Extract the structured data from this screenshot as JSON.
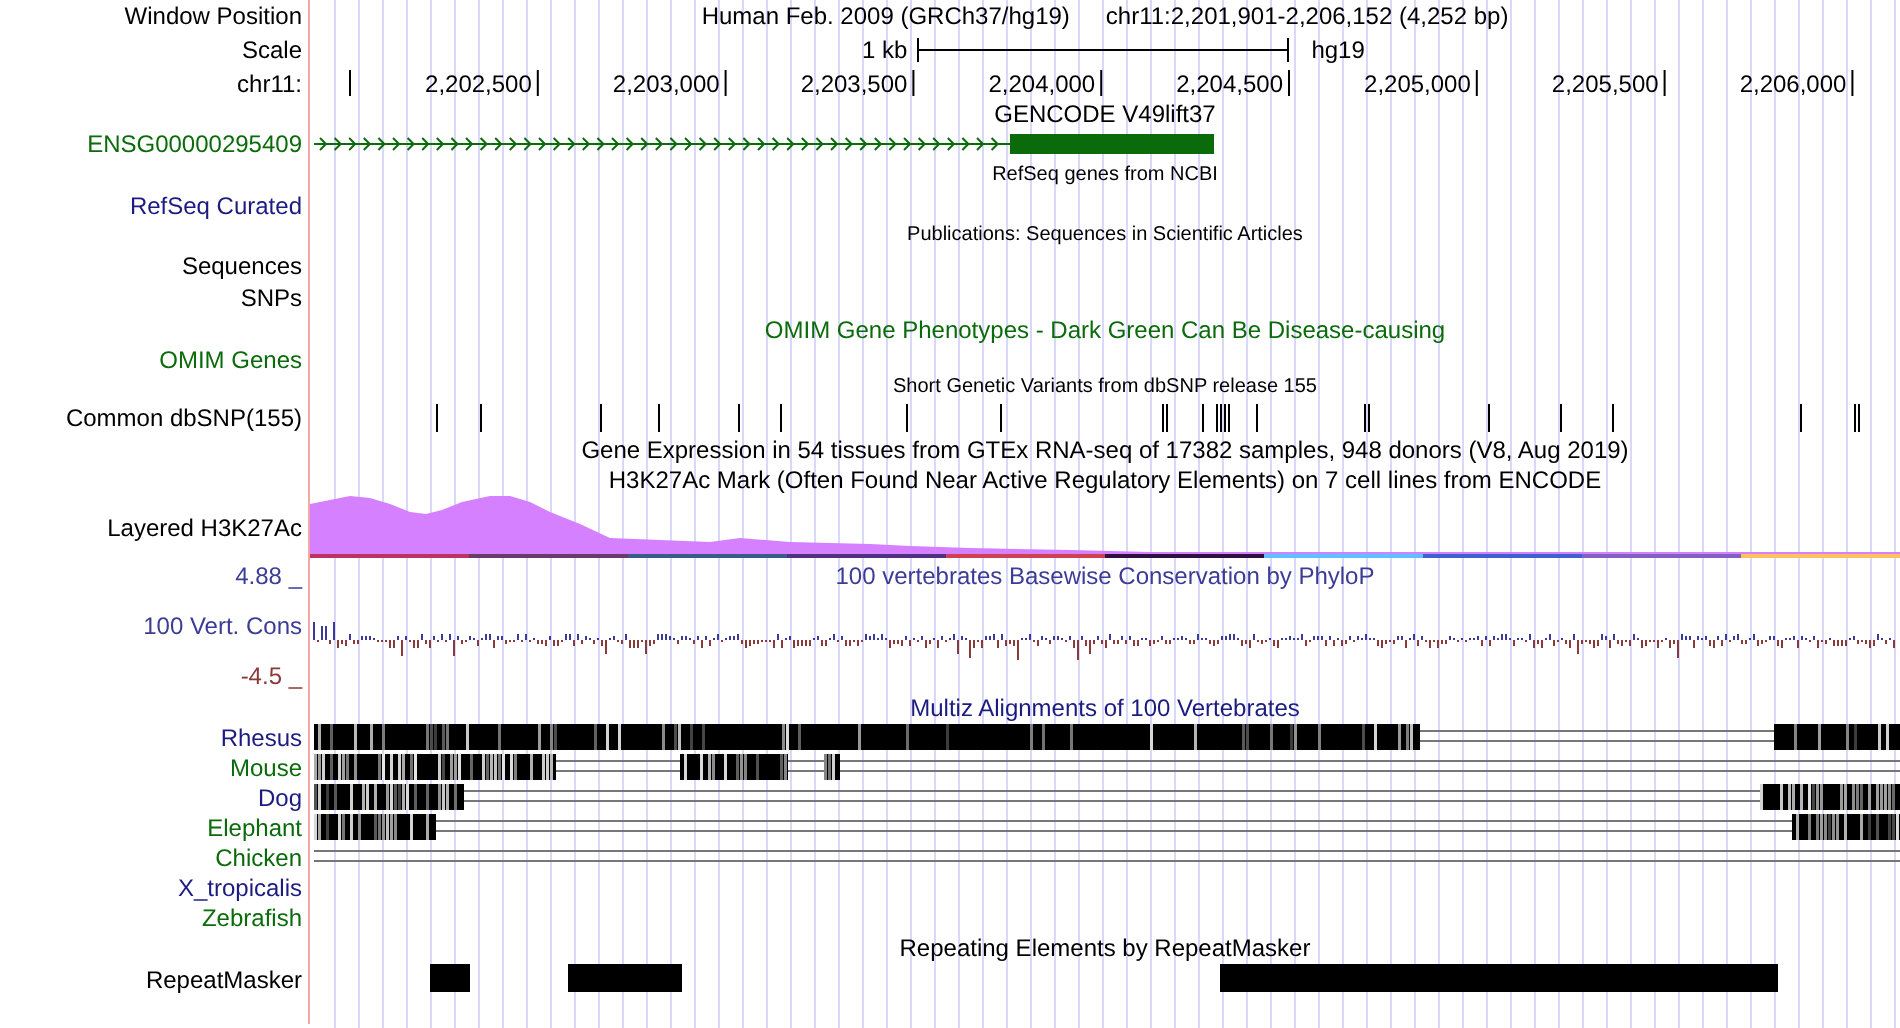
{
  "header": {
    "label": "Window Position",
    "assembly": "Human Feb. 2009 (GRCh37/hg19)",
    "position": "chr11:2,201,901-2,206,152 (4,252 bp)"
  },
  "scale": {
    "label": "Scale",
    "length": "1 kb",
    "assembly": "hg19"
  },
  "ruler": {
    "label": "chr11:",
    "ticks": [
      "2,202,500",
      "2,203,000",
      "2,203,500",
      "2,204,000",
      "2,204,500",
      "2,205,000",
      "2,205,500",
      "2,206,000"
    ]
  },
  "tracks": [
    {
      "kind": "gene",
      "title": {
        "text": "GENCODE V49lift37",
        "kind": "large",
        "color": "#000000"
      },
      "labels": [
        {
          "text": "ENSG00000295409",
          "color": "#0b6b0b"
        }
      ]
    },
    {
      "kind": "empty",
      "title": {
        "text": "RefSeq genes from NCBI",
        "kind": "small",
        "color": "#000000"
      },
      "labels": [
        {
          "text": "RefSeq Curated",
          "color": "#1c1c80"
        }
      ]
    },
    {
      "kind": "empty",
      "title": {
        "text": "Publications: Sequences in Scientific Articles",
        "kind": "small",
        "color": "#000000"
      },
      "labels": [
        {
          "text": "Sequences",
          "color": "#000000"
        },
        {
          "text": "SNPs",
          "color": "#000000"
        }
      ]
    },
    {
      "kind": "empty",
      "title": {
        "text": "OMIM Gene Phenotypes - Dark Green Can Be Disease-causing",
        "kind": "large",
        "color": "#0b6b0b"
      },
      "labels": [
        {
          "text": "OMIM Genes",
          "color": "#0b6b0b"
        }
      ]
    },
    {
      "kind": "snp",
      "title": {
        "text": "Short Genetic Variants from dbSNP release 155",
        "kind": "small",
        "color": "#000000"
      },
      "labels": [
        {
          "text": "Common dbSNP(155)",
          "color": "#000000"
        }
      ]
    },
    {
      "kind": "empty",
      "title": {
        "text": "Gene Expression in 54 tissues from GTEx RNA-seq of 17382 samples, 948 donors (V8, Aug 2019)",
        "kind": "large",
        "color": "#000000"
      }
    },
    {
      "kind": "layered",
      "title": {
        "text": "H3K27Ac Mark (Often Found Near Active Regulatory Elements) on 7 cell lines from ENCODE",
        "kind": "large",
        "color": "#000000"
      },
      "labels": [
        {
          "text": "Layered H3K27Ac",
          "color": "#000000"
        }
      ]
    },
    {
      "kind": "wiggle",
      "title": {
        "text": "100 vertebrates Basewise Conservation by PhyloP",
        "kind": "large",
        "color": "#3c3c96"
      },
      "labels": [
        {
          "text": "100 Vert. Cons",
          "color": "#3c3c96"
        }
      ],
      "max": {
        "text": "4.88 _",
        "color": "#3c3c96"
      },
      "min": {
        "text": "-4.5 _",
        "color": "#8b3a3a"
      }
    },
    {
      "kind": "multiz",
      "title": {
        "text": "Multiz Alignments of 100 Vertebrates",
        "kind": "large",
        "color": "#1c1c80"
      },
      "species": [
        {
          "name": "Rhesus",
          "color": "#1c1c80"
        },
        {
          "name": "Mouse",
          "color": "#0b6b0b"
        },
        {
          "name": "Dog",
          "color": "#1c1c80"
        },
        {
          "name": "Elephant",
          "color": "#0b6b0b"
        },
        {
          "name": "Chicken",
          "color": "#0b6b0b"
        },
        {
          "name": "X_tropicalis",
          "color": "#1c1c80"
        },
        {
          "name": "Zebrafish",
          "color": "#0b6b0b"
        }
      ]
    },
    {
      "kind": "repeat",
      "title": {
        "text": "Repeating Elements by RepeatMasker",
        "kind": "large",
        "color": "#000000"
      },
      "labels": [
        {
          "text": "RepeatMasker",
          "color": "#000000"
        }
      ]
    }
  ]
}
